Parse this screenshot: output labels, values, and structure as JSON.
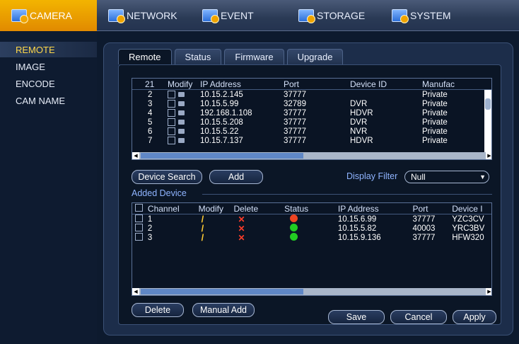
{
  "nav": {
    "items": [
      {
        "label": "CAMERA",
        "active": true
      },
      {
        "label": "NETWORK",
        "active": false
      },
      {
        "label": "EVENT",
        "active": false
      },
      {
        "label": "STORAGE",
        "active": false
      },
      {
        "label": "SYSTEM",
        "active": false
      }
    ]
  },
  "sidebar": {
    "items": [
      {
        "label": "REMOTE",
        "active": true
      },
      {
        "label": "IMAGE",
        "active": false
      },
      {
        "label": "ENCODE",
        "active": false
      },
      {
        "label": "CAM NAME",
        "active": false
      }
    ]
  },
  "tabs": [
    {
      "label": "Remote",
      "active": true
    },
    {
      "label": "Status",
      "active": false
    },
    {
      "label": "Firmware",
      "active": false
    },
    {
      "label": "Upgrade",
      "active": false
    }
  ],
  "search_table": {
    "count_header": "21",
    "headers": [
      "Modify",
      "IP Address",
      "Port",
      "Device ID",
      "Manufac"
    ],
    "rows": [
      {
        "no": "2",
        "ip": "10.15.2.145",
        "port": "37777",
        "device_id": "",
        "manufacturer": "Private"
      },
      {
        "no": "3",
        "ip": "10.15.5.99",
        "port": "32789",
        "device_id": "DVR",
        "manufacturer": "Private"
      },
      {
        "no": "4",
        "ip": "192.168.1.108",
        "port": "37777",
        "device_id": "HDVR",
        "manufacturer": "Private"
      },
      {
        "no": "5",
        "ip": "10.15.5.208",
        "port": "37777",
        "device_id": "DVR",
        "manufacturer": "Private"
      },
      {
        "no": "6",
        "ip": "10.15.5.22",
        "port": "37777",
        "device_id": "NVR",
        "manufacturer": "Private"
      },
      {
        "no": "7",
        "ip": "10.15.7.137",
        "port": "37777",
        "device_id": "HDVR",
        "manufacturer": "Private"
      }
    ]
  },
  "buttons": {
    "device_search": "Device Search",
    "add": "Add",
    "delete": "Delete",
    "manual_add": "Manual Add",
    "save": "Save",
    "cancel": "Cancel",
    "apply": "Apply"
  },
  "filter": {
    "label": "Display Filter",
    "value": "Null"
  },
  "added_device": {
    "section_label": "Added Device",
    "headers": [
      "Channel",
      "Modify",
      "Delete",
      "Status",
      "IP Address",
      "Port",
      "Device I"
    ],
    "rows": [
      {
        "channel": "1",
        "status": "offline",
        "ip": "10.15.6.99",
        "port": "37777",
        "device_id": "YZC3CV"
      },
      {
        "channel": "2",
        "status": "online",
        "ip": "10.15.5.82",
        "port": "40003",
        "device_id": "YRC3BV"
      },
      {
        "channel": "3",
        "status": "online",
        "ip": "10.15.9.136",
        "port": "37777",
        "device_id": "HFW320"
      }
    ]
  },
  "colors": {
    "accent_active": "#f3b400",
    "status_online": "#22cc22",
    "status_offline": "#ee4422",
    "label_blue": "#8fb4ff"
  }
}
